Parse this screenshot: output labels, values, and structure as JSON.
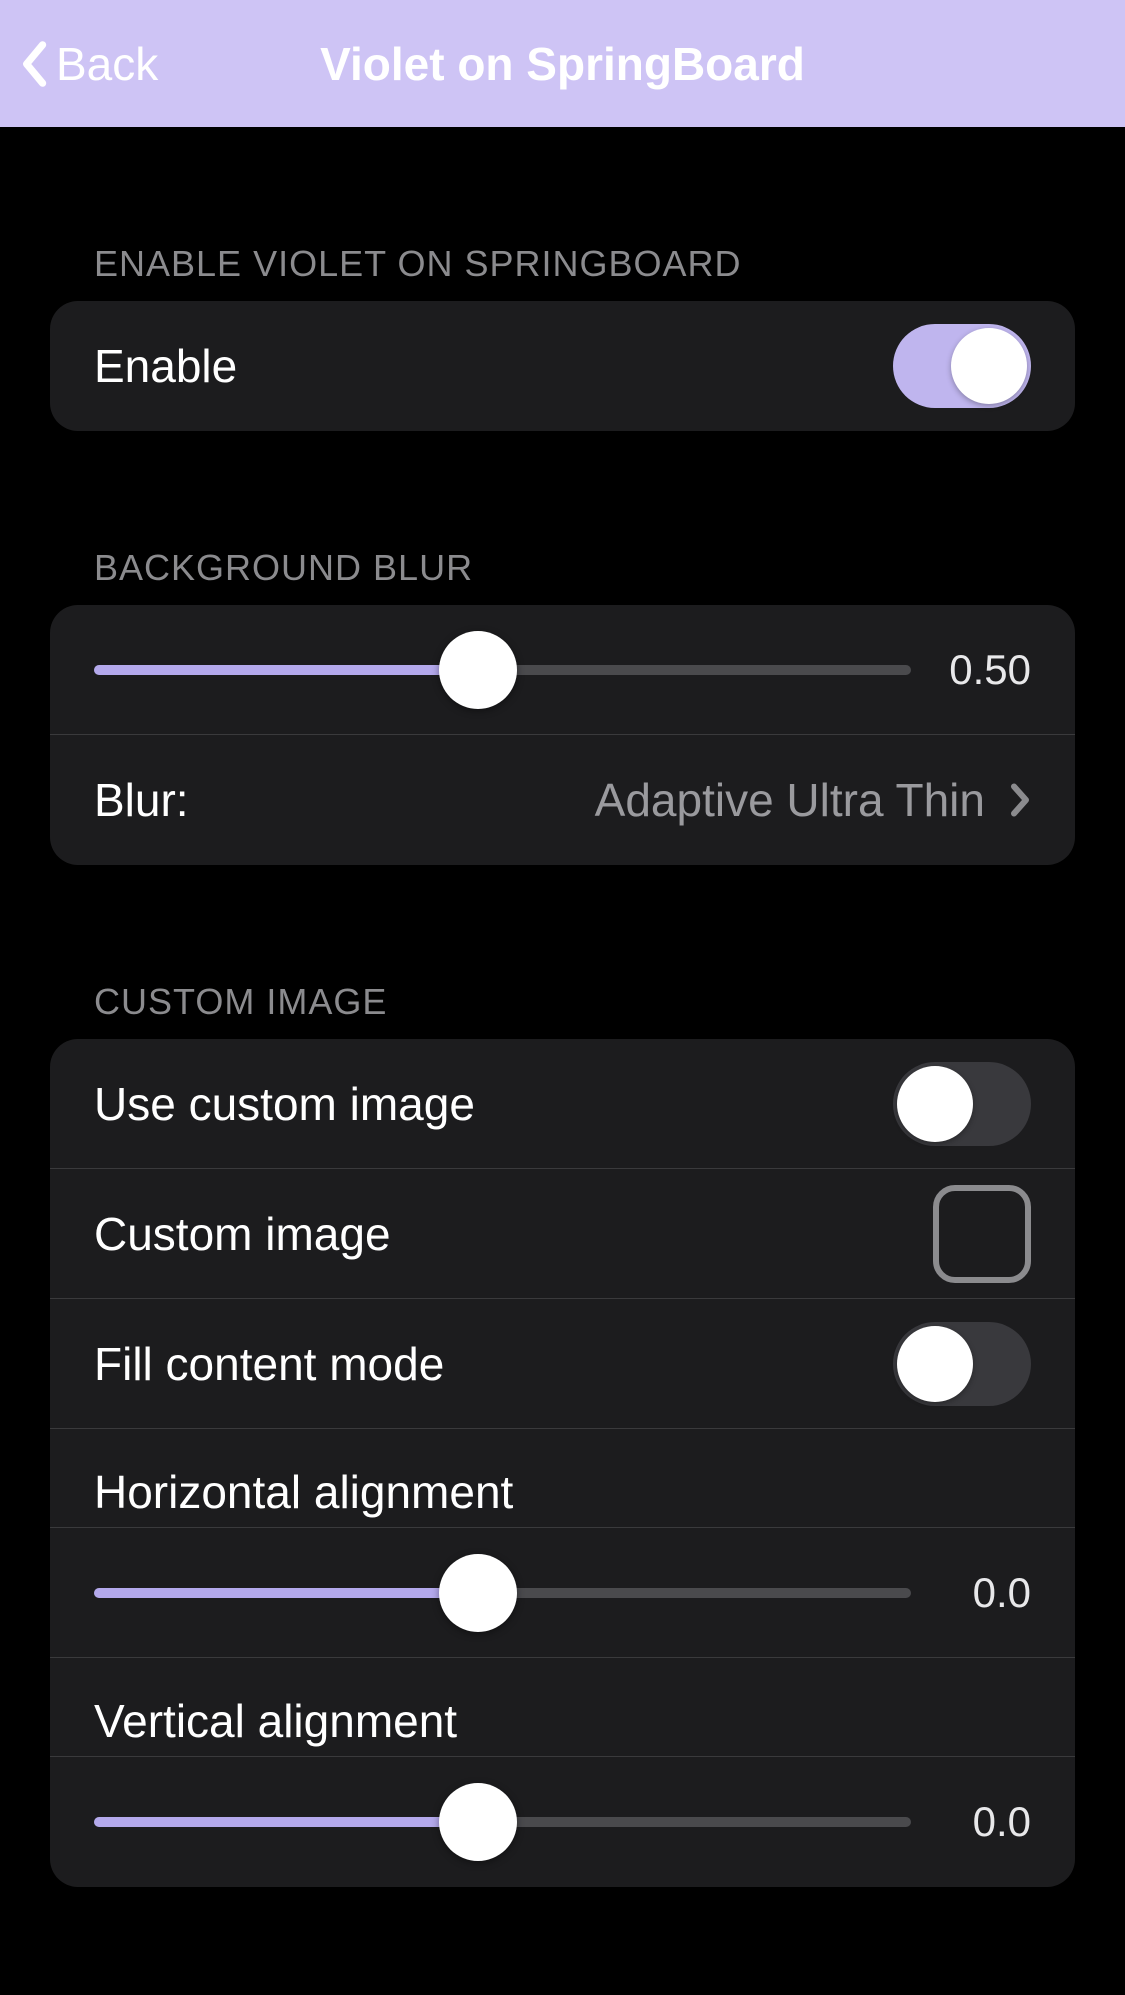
{
  "nav": {
    "back_label": "Back",
    "title": "Violet on SpringBoard"
  },
  "section1": {
    "header": "Enable Violet on SpringBoard",
    "enable_label": "Enable",
    "enable_on": true
  },
  "section2": {
    "header": "Background Blur",
    "slider_value": "0.50",
    "slider_percent": 47,
    "blur_label": "Blur:",
    "blur_value": "Adaptive Ultra Thin"
  },
  "section3": {
    "header": "Custom Image",
    "use_custom_label": "Use custom image",
    "use_custom_on": false,
    "custom_image_label": "Custom image",
    "fill_mode_label": "Fill content mode",
    "fill_mode_on": false,
    "h_align_label": "Horizontal alignment",
    "h_align_value": "0.0",
    "h_align_percent": 47,
    "v_align_label": "Vertical alignment",
    "v_align_value": "0.0",
    "v_align_percent": 47
  }
}
